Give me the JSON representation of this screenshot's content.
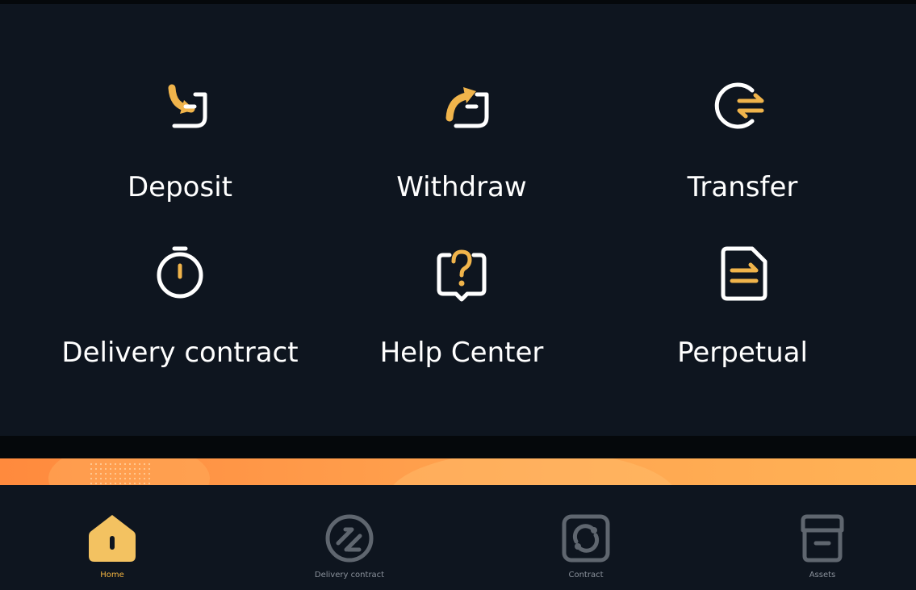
{
  "colors": {
    "accent": "#f0b44b",
    "icon_white": "#ffffff",
    "panel_bg": "#0e151f",
    "inactive": "#5f666f"
  },
  "actions": [
    {
      "id": "deposit",
      "label": "Deposit",
      "icon": "deposit-icon"
    },
    {
      "id": "withdraw",
      "label": "Withdraw",
      "icon": "withdraw-icon"
    },
    {
      "id": "transfer",
      "label": "Transfer",
      "icon": "transfer-icon"
    },
    {
      "id": "delivery-contract",
      "label": "Delivery contract",
      "icon": "stopwatch-icon"
    },
    {
      "id": "help-center",
      "label": "Help Center",
      "icon": "help-bubble-icon"
    },
    {
      "id": "perpetual",
      "label": "Perpetual",
      "icon": "document-swap-icon"
    }
  ],
  "tabbar": {
    "active": "home",
    "tabs": [
      {
        "id": "home",
        "label": "Home",
        "icon": "home-icon"
      },
      {
        "id": "delivery-contract",
        "label": "Delivery contract",
        "icon": "delivery-icon"
      },
      {
        "id": "contract",
        "label": "Contract",
        "icon": "contract-icon"
      },
      {
        "id": "assets",
        "label": "Assets",
        "icon": "assets-icon"
      }
    ]
  }
}
